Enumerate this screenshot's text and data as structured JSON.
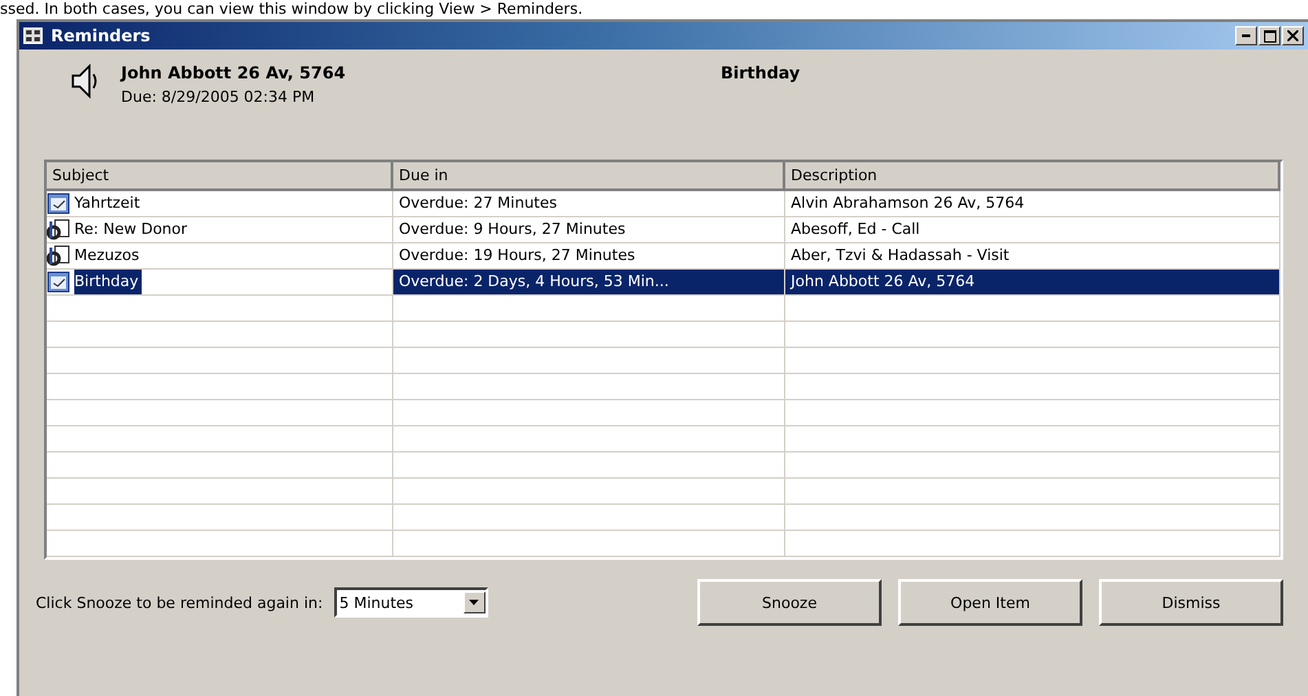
{
  "page_text": "ssed. In both cases, you can view this window by clicking View > Reminders.",
  "window": {
    "title": "Reminders"
  },
  "header": {
    "subject": "John Abbott 26 Av, 5764",
    "due": "Due: 8/29/2005 02:34 PM",
    "category": "Birthday"
  },
  "table": {
    "columns": [
      "Subject",
      "Due in",
      "Description"
    ],
    "rows": [
      {
        "kind": "appointment",
        "subject": "Yahrtzeit",
        "due_in": "Overdue: 27 Minutes",
        "description": "Alvin Abrahamson 26 Av, 5764",
        "selected": false
      },
      {
        "kind": "task",
        "subject": "Re: New Donor",
        "due_in": "Overdue: 9 Hours, 27 Minutes",
        "description": "Abesoff, Ed - Call",
        "selected": false
      },
      {
        "kind": "task",
        "subject": "Mezuzos",
        "due_in": "Overdue: 19 Hours, 27 Minutes",
        "description": "Aber, Tzvi & Hadassah - Visit",
        "selected": false
      },
      {
        "kind": "appointment",
        "subject": "Birthday",
        "due_in": "Overdue: 2 Days, 4 Hours, 53 Min...",
        "description": "John Abbott 26 Av, 5764",
        "selected": true
      }
    ]
  },
  "snooze": {
    "label": "Click Snooze to be reminded again in:",
    "value": "5 Minutes"
  },
  "buttons": [
    "Snooze",
    "Open Item",
    "Dismiss"
  ]
}
